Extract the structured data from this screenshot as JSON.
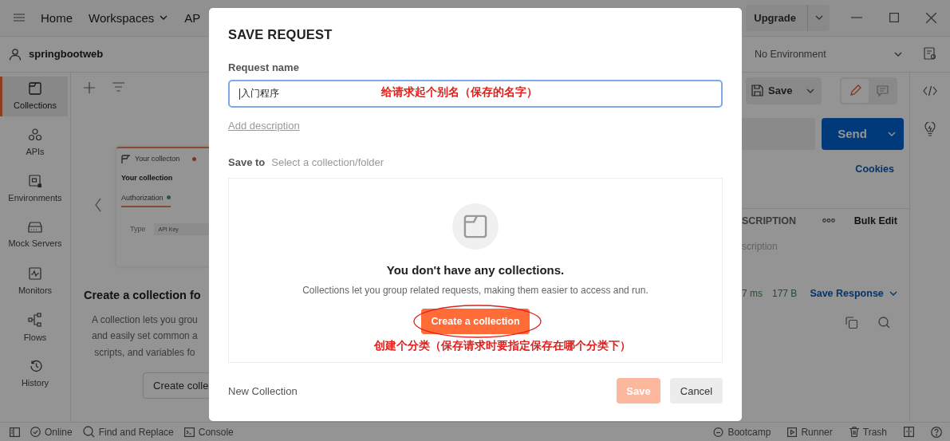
{
  "topbar": {
    "nav": [
      {
        "label": "Home",
        "dropdown": false
      },
      {
        "label": "Workspaces",
        "dropdown": true
      },
      {
        "label": "AP",
        "dropdown": false
      }
    ],
    "upgrade": "Upgrade"
  },
  "workspace": {
    "name": "springbootweb",
    "environment": "No Environment"
  },
  "sidebar": {
    "items": [
      {
        "label": "Collections",
        "selected": true
      },
      {
        "label": "APIs",
        "selected": false
      },
      {
        "label": "Environments",
        "selected": false
      },
      {
        "label": "Mock Servers",
        "selected": false
      },
      {
        "label": "Monitors",
        "selected": false
      },
      {
        "label": "Flows",
        "selected": false
      },
      {
        "label": "History",
        "selected": false
      }
    ]
  },
  "collections_panel": {
    "preview": {
      "tab_title": "Your collecton",
      "heading": "Your collection",
      "tab": "Authorization",
      "field_label": "Type",
      "field_value": "API Key"
    },
    "heading": "Create a collection fo",
    "description_lines": [
      "A collection lets you grou",
      "and easily set common a",
      "scripts, and variables fo"
    ],
    "button": "Create colle"
  },
  "request": {
    "save": "Save",
    "editor_modes": [
      {
        "selected": true
      },
      {
        "selected": false
      }
    ],
    "send": "Send",
    "cookies": "Cookies",
    "params_header": {
      "column_3": "SCRIPTION",
      "bulk_edit": "Bulk Edit"
    },
    "description_placeholder": "scription",
    "response": {
      "time": "7 ms",
      "size": "177 B",
      "save_response": "Save Response"
    }
  },
  "status_bar": {
    "left": [
      "Online",
      "Find and Replace",
      "Console"
    ],
    "right": [
      "Bootcamp",
      "Runner",
      "Trash"
    ]
  },
  "dialog": {
    "title": "SAVE REQUEST",
    "name_label": "Request name",
    "name_value": "入门程序",
    "name_note": "给请求起个别名（保存的名字）",
    "add_description": "Add description",
    "save_to_label": "Save to",
    "save_to_placeholder": "Select a collection/folder",
    "empty_title": "You don't have any collections.",
    "empty_text": "Collections let you group related requests, making them easier to access and run.",
    "create_button": "Create a collection",
    "create_note": "创建个分类（保存请求时要指定保存在哪个分类下）",
    "new_collection": "New Collection",
    "save_button": {
      "label": "Save",
      "disabled": true
    },
    "cancel": "Cancel"
  }
}
